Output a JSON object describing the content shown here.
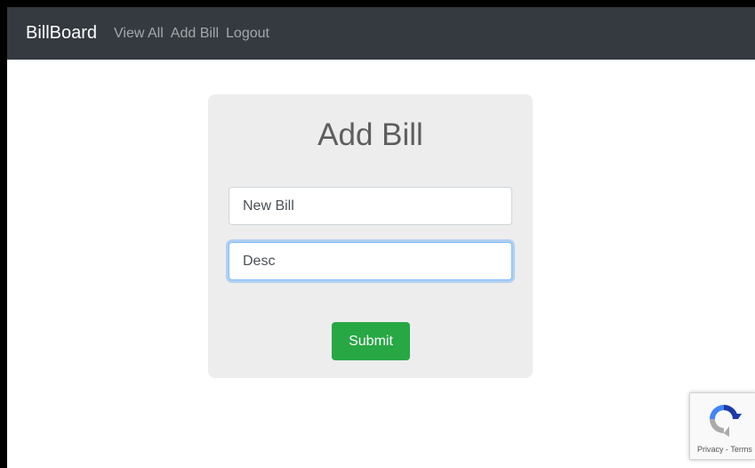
{
  "navbar": {
    "brand": "BillBoard",
    "links": [
      "View All",
      "Add Bill",
      "Logout"
    ]
  },
  "form": {
    "heading": "Add Bill",
    "title_value": "New Bill",
    "description_value": "Desc",
    "submit_label": "Submit"
  },
  "recaptcha": {
    "privacy_label": "Privacy",
    "separator": " - ",
    "terms_label": "Terms",
    "icon": "recaptcha-logo-icon"
  },
  "colors": {
    "navbar_bg": "#343a40",
    "card_bg": "#ededed",
    "submit_bg": "#28a745",
    "focus_border": "#80bdff"
  }
}
